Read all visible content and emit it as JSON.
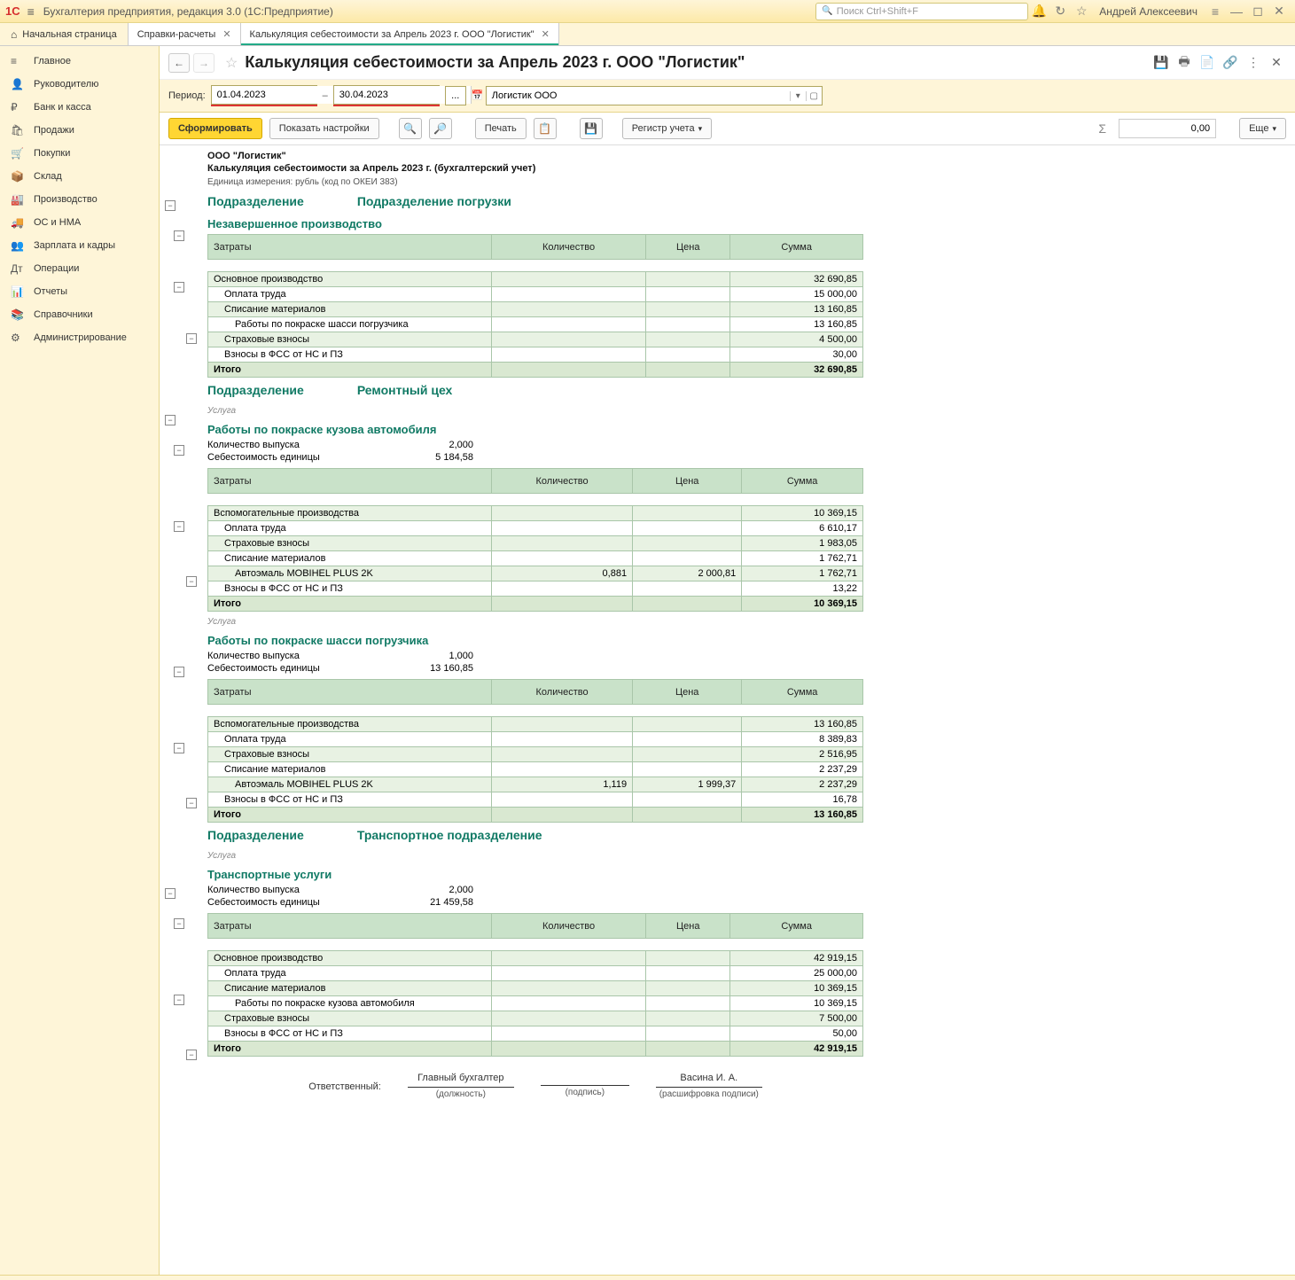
{
  "titlebar": {
    "logo": "1С",
    "app_title": "Бухгалтерия предприятия, редакция 3.0  (1С:Предприятие)",
    "search_placeholder": "Поиск Ctrl+Shift+F",
    "user": "Андрей Алексеевич"
  },
  "tabs": {
    "start": "Начальная страница",
    "items": [
      {
        "label": "Справки-расчеты",
        "active": false
      },
      {
        "label": "Калькуляция себестоимости за Апрель 2023 г. ООО \"Логистик\"",
        "active": true
      }
    ]
  },
  "sidebar": {
    "items": [
      {
        "icon": "≡",
        "label": "Главное"
      },
      {
        "icon": "👤",
        "label": "Руководителю"
      },
      {
        "icon": "₽",
        "label": "Банк и касса"
      },
      {
        "icon": "🛍",
        "label": "Продажи"
      },
      {
        "icon": "🛒",
        "label": "Покупки"
      },
      {
        "icon": "📦",
        "label": "Склад"
      },
      {
        "icon": "🏭",
        "label": "Производство"
      },
      {
        "icon": "🚚",
        "label": "ОС и НМА"
      },
      {
        "icon": "👥",
        "label": "Зарплата и кадры"
      },
      {
        "icon": "Дт",
        "label": "Операции"
      },
      {
        "icon": "📊",
        "label": "Отчеты"
      },
      {
        "icon": "📚",
        "label": "Справочники"
      },
      {
        "icon": "⚙",
        "label": "Администрирование"
      }
    ]
  },
  "header": {
    "title": "Калькуляция себестоимости за Апрель 2023 г. ООО \"Логистик\""
  },
  "period": {
    "label": "Период:",
    "from": "01.04.2023",
    "dash": "–",
    "to": "30.04.2023",
    "dots": "...",
    "org": "Логистик ООО"
  },
  "toolbar": {
    "form": "Сформировать",
    "settings": "Показать настройки",
    "print": "Печать",
    "register": "Регистр учета",
    "sigma": "Σ",
    "sum": "0,00",
    "more": "Еще"
  },
  "report": {
    "org": "ООО \"Логистик\"",
    "title": "Калькуляция себестоимости за Апрель 2023 г. (бухгалтерский учет)",
    "unit": "Единица измерения: рубль (код по ОКЕИ 383)",
    "cols": {
      "name": "Затраты",
      "qty": "Количество",
      "price": "Цена",
      "sum": "Сумма"
    },
    "section_label": "Подразделение",
    "q_label": "Количество выпуска",
    "c_label": "Себестоимость единицы",
    "total_label": "Итого",
    "service_tag": "Услуга",
    "responsible": "Ответственный:",
    "position_value": "Главный бухгалтер",
    "position_label": "(должность)",
    "sign_label": "(подпись)",
    "name_value": "Васина И. А.",
    "name_label": "(расшифровка подписи)",
    "sections": [
      {
        "name": "Подразделение погрузки",
        "wip_title": "Незавершенное производство",
        "wip_rows": [
          {
            "lvl": 0,
            "name": "Основное производство",
            "sum": "32 690,85",
            "alt": true
          },
          {
            "lvl": 1,
            "name": "Оплата труда",
            "sum": "15 000,00"
          },
          {
            "lvl": 1,
            "name": "Списание материалов",
            "sum": "13 160,85",
            "alt": true
          },
          {
            "lvl": 2,
            "name": "Работы по покраске шасси погрузчика",
            "sum": "13 160,85"
          },
          {
            "lvl": 1,
            "name": "Страховые взносы",
            "sum": "4 500,00",
            "alt": true
          },
          {
            "lvl": 1,
            "name": "Взносы в ФСС от НС и ПЗ",
            "sum": "30,00"
          }
        ],
        "total": "32 690,85"
      },
      {
        "name": "Ремонтный цех",
        "services": [
          {
            "title": "Работы по покраске кузова автомобиля",
            "qty": "2,000",
            "cost": "5 184,58",
            "rows": [
              {
                "lvl": 0,
                "name": "Вспомогательные производства",
                "sum": "10 369,15",
                "alt": true
              },
              {
                "lvl": 1,
                "name": "Оплата труда",
                "sum": "6 610,17"
              },
              {
                "lvl": 1,
                "name": "Страховые взносы",
                "sum": "1 983,05",
                "alt": true
              },
              {
                "lvl": 1,
                "name": "Списание материалов",
                "sum": "1 762,71"
              },
              {
                "lvl": 2,
                "name": "Автоэмаль MOBIHEL PLUS 2K",
                "qty": "0,881",
                "price": "2 000,81",
                "sum": "1 762,71",
                "alt": true
              },
              {
                "lvl": 1,
                "name": "Взносы в ФСС от НС и ПЗ",
                "sum": "13,22"
              }
            ],
            "total": "10 369,15"
          },
          {
            "title": "Работы по покраске шасси погрузчика",
            "qty": "1,000",
            "cost": "13 160,85",
            "rows": [
              {
                "lvl": 0,
                "name": "Вспомогательные производства",
                "sum": "13 160,85",
                "alt": true
              },
              {
                "lvl": 1,
                "name": "Оплата труда",
                "sum": "8 389,83"
              },
              {
                "lvl": 1,
                "name": "Страховые взносы",
                "sum": "2 516,95",
                "alt": true
              },
              {
                "lvl": 1,
                "name": "Списание материалов",
                "sum": "2 237,29"
              },
              {
                "lvl": 2,
                "name": "Автоэмаль MOBIHEL PLUS 2K",
                "qty": "1,119",
                "price": "1 999,37",
                "sum": "2 237,29",
                "alt": true
              },
              {
                "lvl": 1,
                "name": "Взносы в ФСС от НС и ПЗ",
                "sum": "16,78"
              }
            ],
            "total": "13 160,85"
          }
        ]
      },
      {
        "name": "Транспортное подразделение",
        "services": [
          {
            "title": "Транспортные услуги",
            "qty": "2,000",
            "cost": "21 459,58",
            "rows": [
              {
                "lvl": 0,
                "name": "Основное производство",
                "sum": "42 919,15",
                "alt": true
              },
              {
                "lvl": 1,
                "name": "Оплата труда",
                "sum": "25 000,00"
              },
              {
                "lvl": 1,
                "name": "Списание материалов",
                "sum": "10 369,15",
                "alt": true
              },
              {
                "lvl": 2,
                "name": "Работы по покраске кузова автомобиля",
                "sum": "10 369,15"
              },
              {
                "lvl": 1,
                "name": "Страховые взносы",
                "sum": "7 500,00",
                "alt": true
              },
              {
                "lvl": 1,
                "name": "Взносы в ФСС от НС и ПЗ",
                "sum": "50,00"
              }
            ],
            "total": "42 919,15"
          }
        ]
      }
    ]
  }
}
